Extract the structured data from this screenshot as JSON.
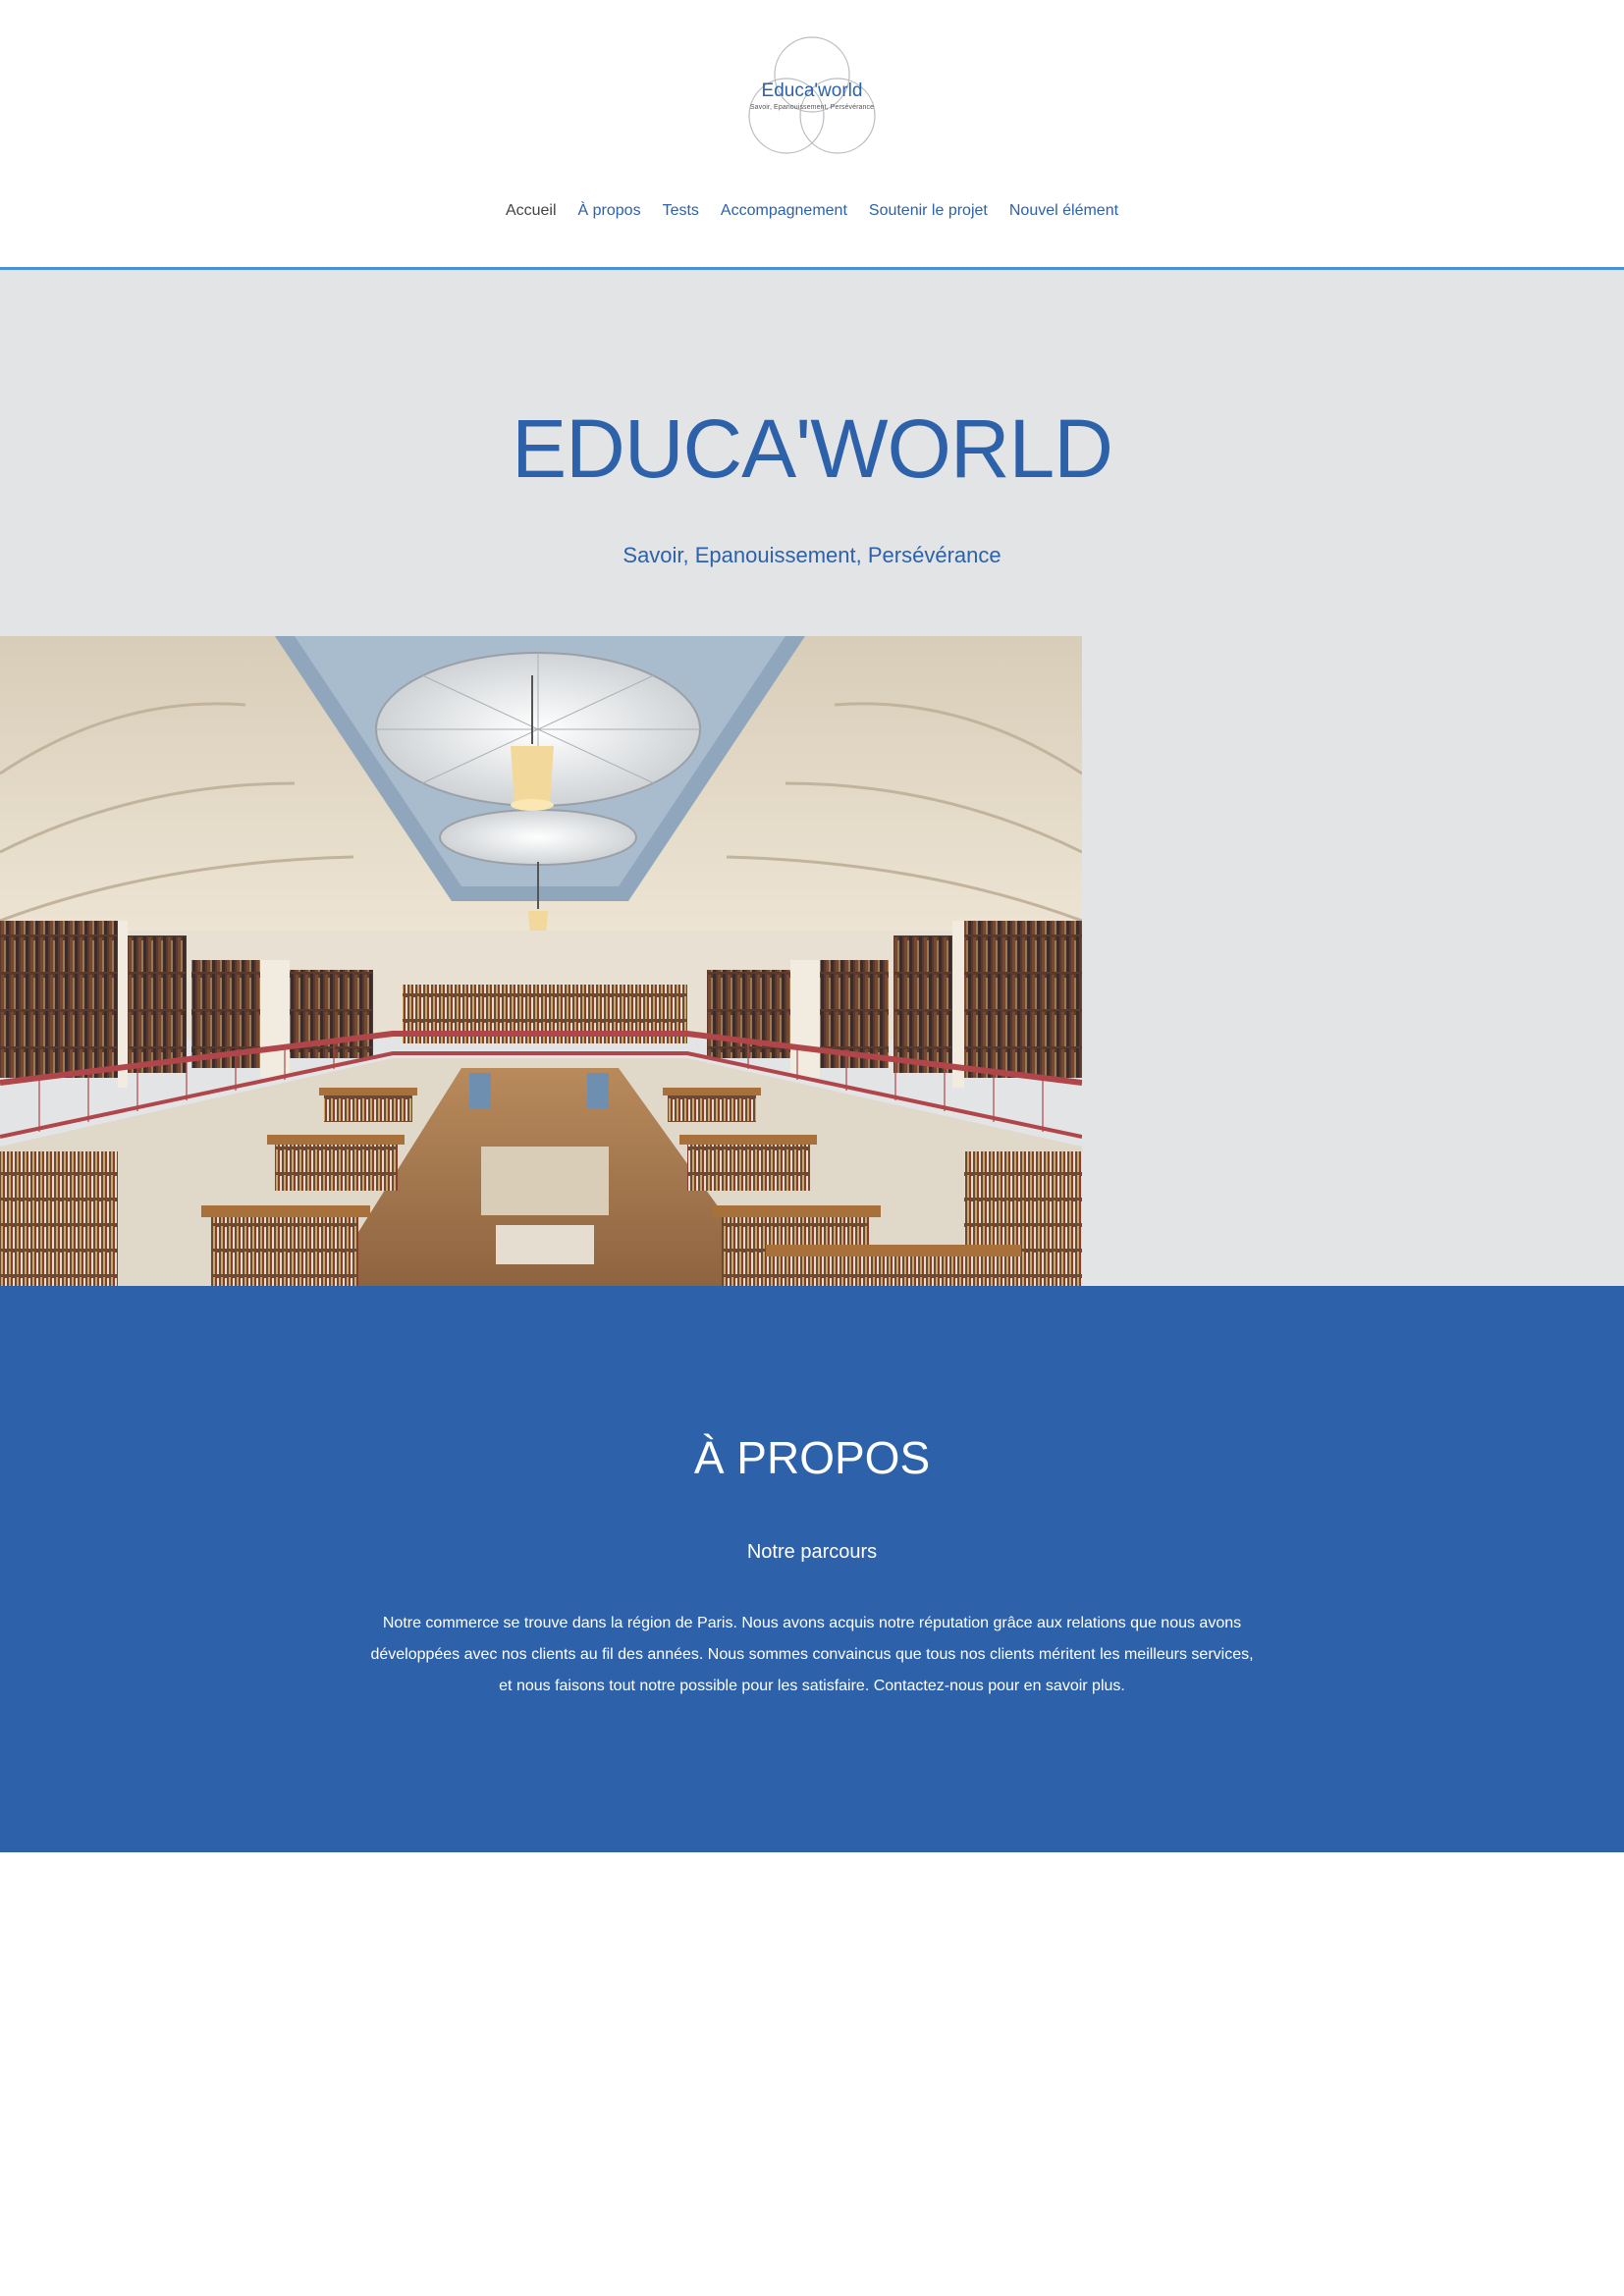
{
  "header": {
    "logo": {
      "title": "Educa'world",
      "tagline": "Savoir, Epanouissement, Persévérance"
    },
    "nav": [
      {
        "label": "Accueil",
        "current": true
      },
      {
        "label": "À propos",
        "current": false
      },
      {
        "label": "Tests",
        "current": false
      },
      {
        "label": "Accompagnement",
        "current": false
      },
      {
        "label": "Soutenir le projet",
        "current": false
      },
      {
        "label": "Nouvel élément",
        "current": false
      }
    ]
  },
  "hero": {
    "title": "EDUCA'WORLD",
    "subtitle": "Savoir, Epanouissement, Persévérance",
    "image": "library-interior-photo"
  },
  "about": {
    "title": "À PROPOS",
    "subtitle": "Notre parcours",
    "text": "Notre commerce se trouve dans la région de Paris. Nous avons acquis notre réputation grâce aux relations que nous avons développées avec nos clients au fil des années. Nous sommes convaincus que tous nos clients méritent les meilleurs services, et nous faisons tout notre possible pour les satisfaire. Contactez-nous pour en savoir plus."
  },
  "colors": {
    "brand_blue": "#2d61a9",
    "divider_blue": "#4a90d6",
    "hero_bg": "#e3e4e6",
    "about_bg": "#2d61a9"
  }
}
